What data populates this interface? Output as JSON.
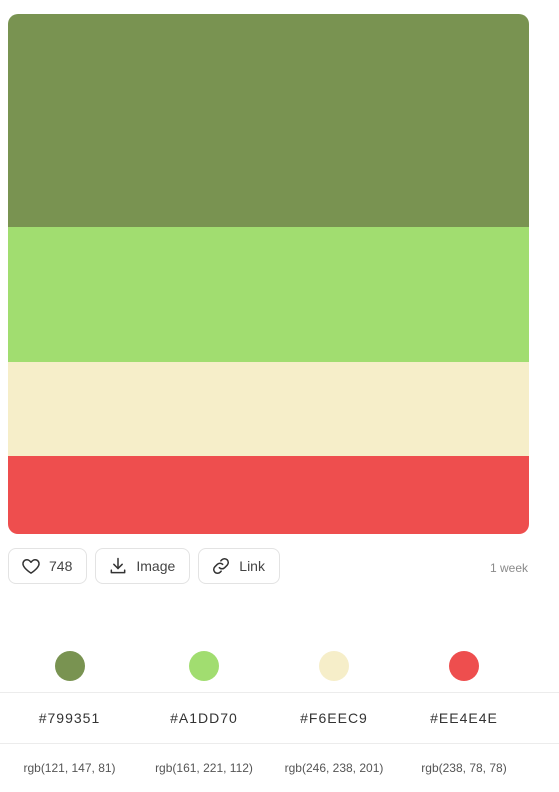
{
  "palette": [
    {
      "hex": "#799351",
      "rgb": "rgb(121, 147, 81)",
      "color": "#799351"
    },
    {
      "hex": "#A1DD70",
      "rgb": "rgb(161, 221, 112)",
      "color": "#A1DD70"
    },
    {
      "hex": "#F6EEC9",
      "rgb": "rgb(246, 238, 201)",
      "color": "#F6EEC9"
    },
    {
      "hex": "#EE4E4E",
      "rgb": "rgb(238, 78, 78)",
      "color": "#EE4E4E"
    }
  ],
  "actions": {
    "likes": "748",
    "image_label": "Image",
    "link_label": "Link"
  },
  "meta": {
    "time_ago": "1 week"
  },
  "icons": {
    "like": "heart-icon",
    "image": "download-icon",
    "link": "link-icon"
  }
}
